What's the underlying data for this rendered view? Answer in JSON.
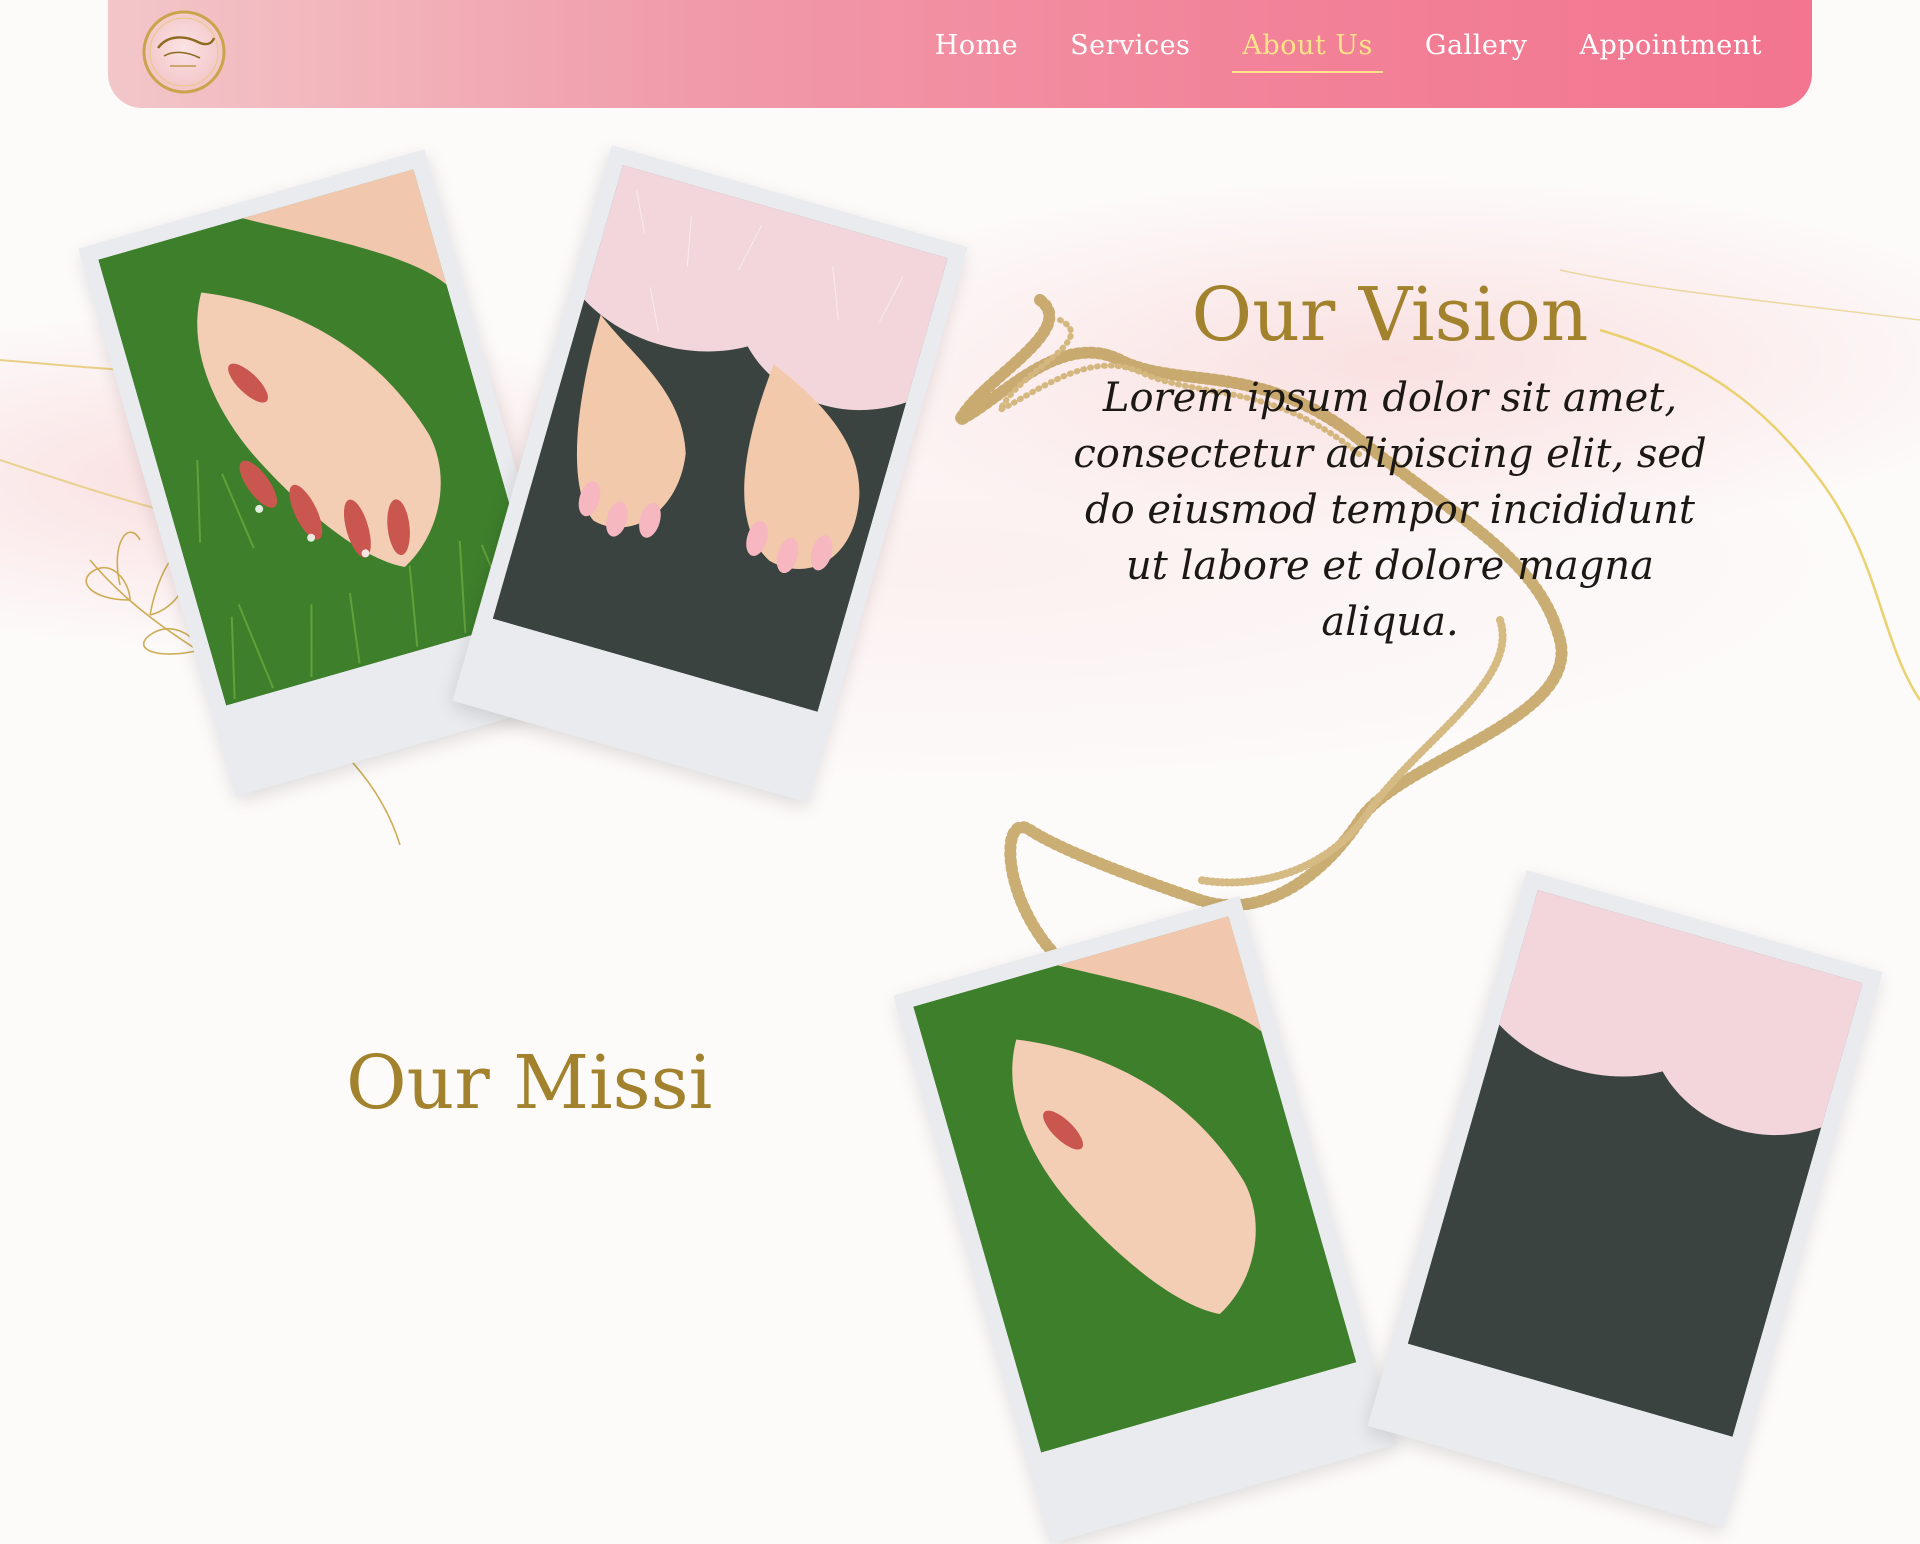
{
  "header": {
    "logo_icon": "claudy-nails-logo",
    "nav": [
      {
        "label": "Home",
        "active": false
      },
      {
        "label": "Services",
        "active": false
      },
      {
        "label": "About Us",
        "active": true
      },
      {
        "label": "Gallery",
        "active": false
      },
      {
        "label": "Appointment",
        "active": false
      }
    ]
  },
  "vision": {
    "title": "Our Vision",
    "text": "Lorem ipsum dolor sit amet, consectetur adipiscing elit, sed do eiusmod tempor incididunt ut labore et dolore magna aliqua."
  },
  "mission": {
    "title": "Our Missi"
  },
  "colors": {
    "header_start": "#f2c7c9",
    "header_end": "#f3758f",
    "nav_active": "#ffe38a",
    "title_gold": "#a2822d",
    "body_text": "#1c1814"
  }
}
